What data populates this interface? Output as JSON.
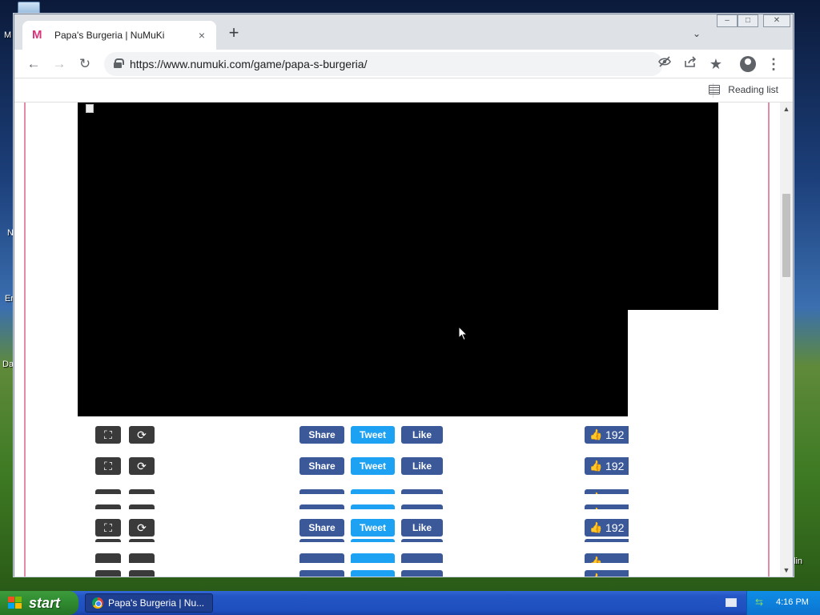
{
  "desktop": {
    "labels": [
      "M",
      "N",
      "Er",
      "Da",
      "lin"
    ]
  },
  "browser": {
    "tab": {
      "favicon": "M",
      "title": "Papa's Burgeria | NuMuKi",
      "close": "×"
    },
    "new_tab": "+",
    "tab_search": "⌄",
    "window_buttons": {
      "minimize": "–",
      "maximize": "□",
      "close": "✕"
    },
    "nav": {
      "back": "←",
      "forward": "→",
      "reload": "↻"
    },
    "url": "https://www.numuki.com/game/papa-s-burgeria/",
    "icons": {
      "tracking": "eye-slash-icon",
      "share": "share-icon",
      "bookmark": "★",
      "menu": "⋮"
    },
    "reading_list": "Reading list"
  },
  "page": {
    "controls": {
      "fullscreen": "⛶",
      "reload": "⟳",
      "share": "Share",
      "tweet": "Tweet",
      "like": "Like",
      "like_count": "192"
    }
  },
  "taskbar": {
    "start": "start",
    "task_item": "Papa's Burgeria | Nu...",
    "clock": "4:16 PM"
  },
  "colors": {
    "facebook": "#3b5998",
    "twitter": "#1da1f2",
    "page_border_accent": "#e58aa6",
    "taskbar": "#2456c6",
    "start_button": "#2f8a2f"
  }
}
